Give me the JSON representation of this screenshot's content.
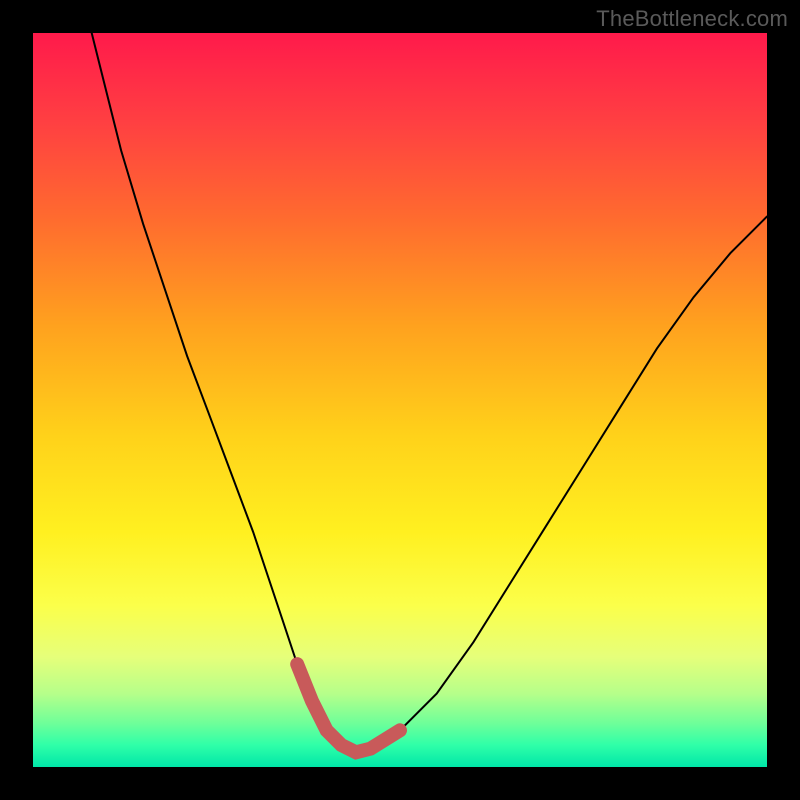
{
  "watermark": "TheBottleneck.com",
  "chart_data": {
    "type": "line",
    "title": "",
    "xlabel": "",
    "ylabel": "",
    "xlim": [
      0,
      100
    ],
    "ylim": [
      0,
      100
    ],
    "series": [
      {
        "name": "bottleneck-curve",
        "x": [
          8,
          10,
          12,
          15,
          18,
          21,
          24,
          27,
          30,
          32,
          34,
          36,
          38,
          40,
          42,
          44,
          46,
          50,
          55,
          60,
          65,
          70,
          75,
          80,
          85,
          90,
          95,
          100
        ],
        "values": [
          100,
          92,
          84,
          74,
          65,
          56,
          48,
          40,
          32,
          26,
          20,
          14,
          9,
          5,
          3,
          2,
          2.5,
          5,
          10,
          17,
          25,
          33,
          41,
          49,
          57,
          64,
          70,
          75
        ]
      }
    ],
    "highlight": {
      "name": "optimal-range",
      "x_range": [
        36,
        50
      ],
      "color": "#c85a5a"
    },
    "gradient_stops": [
      {
        "pos": 0,
        "color": "#ff1a4b"
      },
      {
        "pos": 25,
        "color": "#ff6a2f"
      },
      {
        "pos": 55,
        "color": "#ffd21a"
      },
      {
        "pos": 78,
        "color": "#fbff4a"
      },
      {
        "pos": 100,
        "color": "#00e7a8"
      }
    ]
  }
}
